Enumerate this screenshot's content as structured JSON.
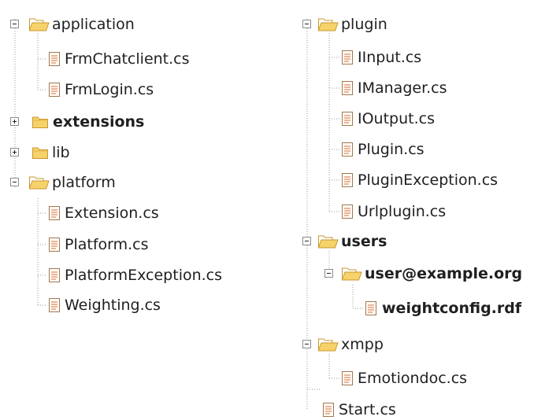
{
  "tree": {
    "left": {
      "application": {
        "label": "application",
        "children": [
          "FrmChatclient.cs",
          "FrmLogin.cs"
        ]
      },
      "extensions": {
        "label": "extensions"
      },
      "lib": {
        "label": "lib"
      },
      "platform": {
        "label": "platform",
        "children": [
          "Extension.cs",
          "Platform.cs",
          "PlatformException.cs",
          "Weighting.cs"
        ]
      }
    },
    "right": {
      "plugin": {
        "label": "plugin",
        "children": [
          "IInput.cs",
          "IManager.cs",
          "IOutput.cs",
          "Plugin.cs",
          "PluginException.cs",
          "Urlplugin.cs"
        ]
      },
      "users": {
        "label": "users",
        "user": {
          "label": "user@example.org",
          "children": [
            "weightconfig.rdf"
          ]
        }
      },
      "xmpp": {
        "label": "xmpp",
        "children": [
          "Emotiondoc.cs"
        ]
      },
      "start": "Start.cs"
    }
  },
  "colors": {
    "folder_fill": "#f6d26a",
    "folder_stroke": "#c9962e",
    "file_stroke": "#a07850",
    "file_lines": "#d86a3a",
    "connector": "#9a9a9a"
  },
  "icons": {
    "folder_open": "folder-open-icon",
    "folder_closed": "folder-icon",
    "file": "file-icon",
    "expand": "plus-box-icon",
    "collapse": "minus-box-icon"
  }
}
